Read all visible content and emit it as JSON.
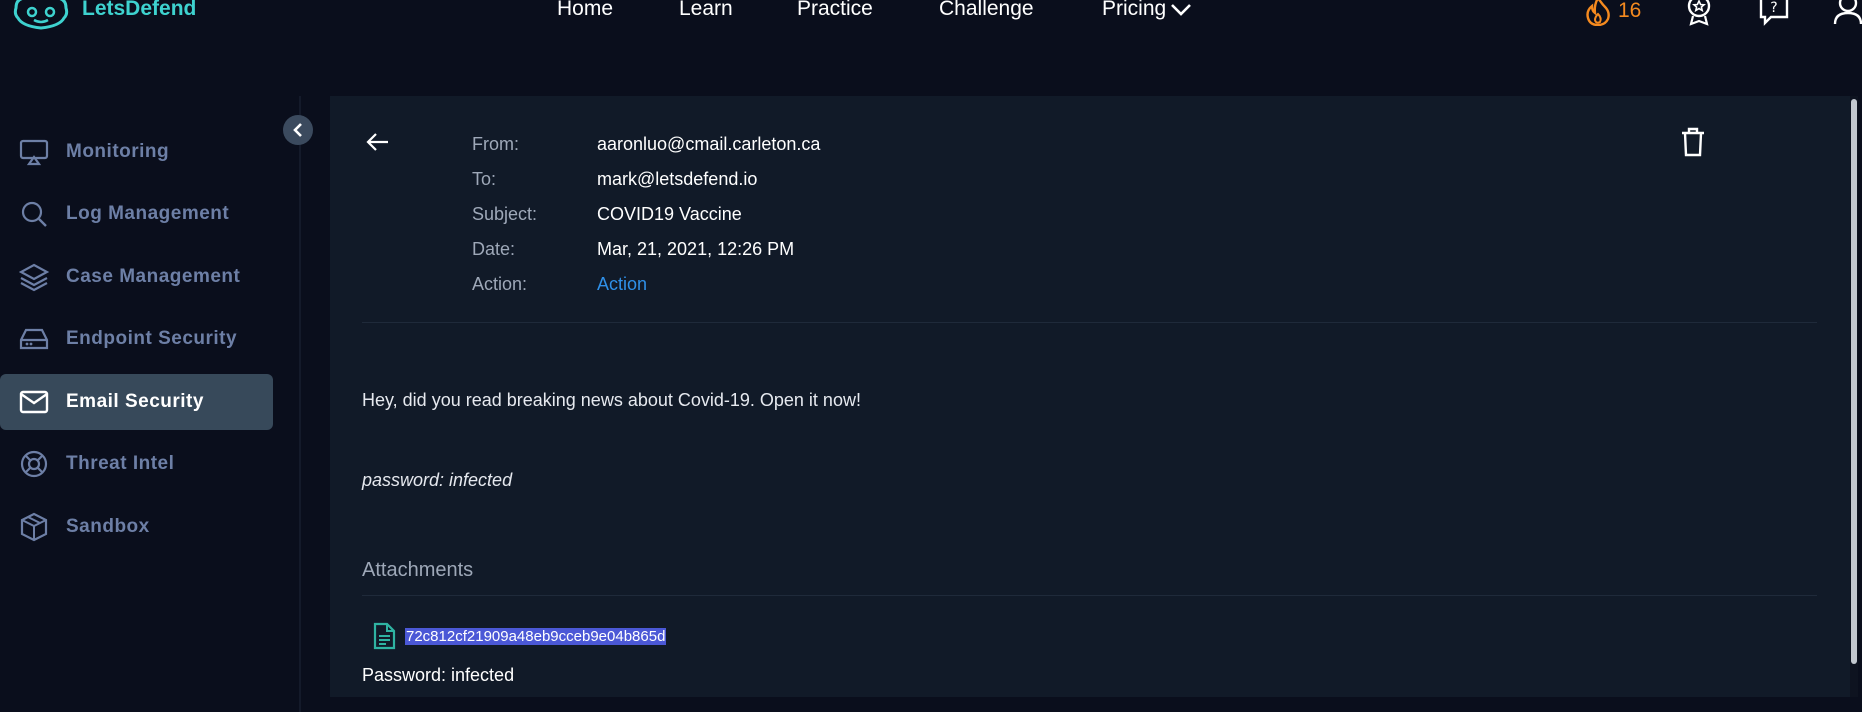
{
  "brand": {
    "name": "LetsDefend"
  },
  "nav": {
    "items": [
      "Home",
      "Learn",
      "Practice",
      "Challenge",
      "Pricing"
    ],
    "streak_count": "16"
  },
  "sidebar": {
    "items": [
      {
        "label": "Monitoring",
        "icon": "monitor-icon"
      },
      {
        "label": "Log Management",
        "icon": "search-icon"
      },
      {
        "label": "Case Management",
        "icon": "layers-icon"
      },
      {
        "label": "Endpoint Security",
        "icon": "hard-drive-icon"
      },
      {
        "label": "Email Security",
        "icon": "mail-icon",
        "active": true
      },
      {
        "label": "Threat Intel",
        "icon": "lifebuoy-icon"
      },
      {
        "label": "Sandbox",
        "icon": "box-icon"
      }
    ]
  },
  "email": {
    "from_label": "From:",
    "from": "aaronluo@cmail.carleton.ca",
    "to_label": "To:",
    "to": "mark@letsdefend.io",
    "subject_label": "Subject:",
    "subject": "COVID19 Vaccine",
    "date_label": "Date:",
    "date": "Mar, 21, 2021, 12:26 PM",
    "action_label": "Action:",
    "action": "Action",
    "body": "Hey, did you read breaking news about Covid-19. Open it now!",
    "password_note": "password: infected",
    "attachments_title": "Attachments",
    "attachment_name": "72c812cf21909a48eb9cceb9e04b865d",
    "attachment_password": "Password: infected"
  },
  "colors": {
    "accent": "#3ed2cf",
    "streak": "#f58a1f",
    "link": "#2f90e8",
    "selection": "#4b58d6",
    "active_item": "#37495a"
  }
}
